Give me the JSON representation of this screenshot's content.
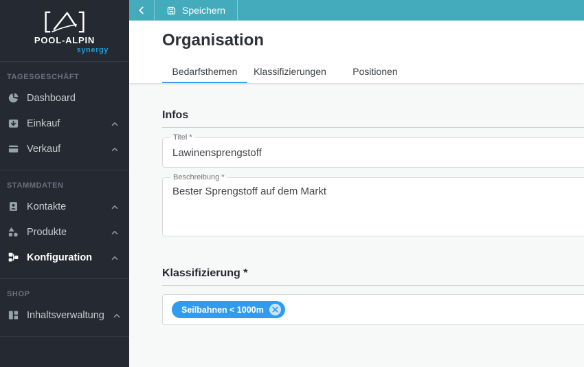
{
  "colors": {
    "topbar_teal": "#43abbc",
    "sidebar_bg": "#252a32",
    "tab_underline_blue": "#3b9cf5",
    "chip_blue": "#2f9cf1",
    "logo_blue": "#1e9cd7"
  },
  "sidebar": {
    "logo": {
      "brand": "POOL-ALPIN",
      "sub": "synergy",
      "mark_icon": "mountain-brackets-logo"
    },
    "sections": [
      {
        "label": "TAGESGESCHÄFT",
        "items": [
          {
            "label": "Dashboard",
            "icon": "dashboard-pie-icon",
            "expandable": false,
            "active": false
          },
          {
            "label": "Einkauf",
            "icon": "purchase-inbox-icon",
            "expandable": true,
            "active": false
          },
          {
            "label": "Verkauf",
            "icon": "credit-card-icon",
            "expandable": true,
            "active": false
          }
        ]
      },
      {
        "label": "STAMMDATEN",
        "items": [
          {
            "label": "Kontakte",
            "icon": "contact-badge-icon",
            "expandable": true,
            "active": false
          },
          {
            "label": "Produkte",
            "icon": "shapes-icon",
            "expandable": true,
            "active": false
          },
          {
            "label": "Konfiguration",
            "icon": "schema-icon",
            "expandable": true,
            "active": true
          }
        ]
      },
      {
        "label": "SHOP",
        "items": [
          {
            "label": "Inhaltsverwaltung",
            "icon": "layout-dashboard-icon",
            "expandable": true,
            "active": false
          }
        ]
      }
    ]
  },
  "topbar": {
    "back_icon": "chevron-left-icon",
    "save_icon": "floppy-disk-icon",
    "save_label": "Speichern"
  },
  "header": {
    "title": "Organisation",
    "tabs": [
      {
        "label": "Bedarfsthemen",
        "active": true
      },
      {
        "label": "Klassifizierungen",
        "active": false
      },
      {
        "label": "Positionen",
        "active": false
      }
    ]
  },
  "form": {
    "infos_heading": "Infos",
    "titel": {
      "label": "Titel *",
      "value": "Lawinensprengstoff"
    },
    "beschreibung": {
      "label": "Beschreibung *",
      "value": "Bester Sprengstoff auf dem Markt"
    },
    "klassifizierung_heading": "Klassifizierung *",
    "chip": {
      "label": "Seilbahnen < 1000m",
      "remove_icon": "close-circle-icon"
    }
  }
}
